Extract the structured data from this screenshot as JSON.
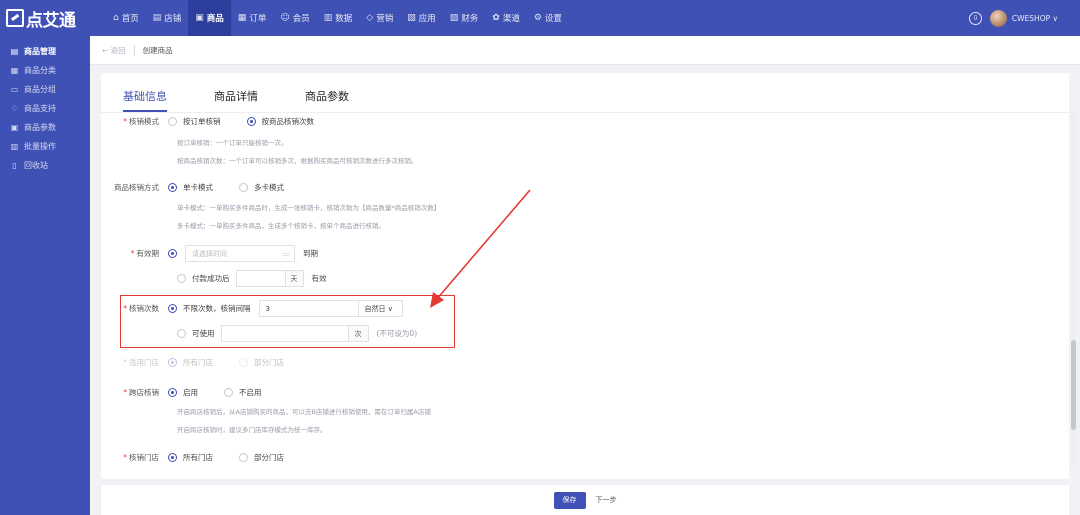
{
  "brand": {
    "logo_text": "点艾通"
  },
  "nav": [
    {
      "label": "首页",
      "icon": "home-icon",
      "glyph": "⌂"
    },
    {
      "label": "店铺",
      "icon": "store-icon",
      "glyph": "▤"
    },
    {
      "label": "商品",
      "icon": "goods-icon",
      "glyph": "▣",
      "active": true
    },
    {
      "label": "订单",
      "icon": "order-icon",
      "glyph": "▦"
    },
    {
      "label": "会员",
      "icon": "member-icon",
      "glyph": "☺"
    },
    {
      "label": "数据",
      "icon": "data-icon",
      "glyph": "▥"
    },
    {
      "label": "营销",
      "icon": "marketing-icon",
      "glyph": "◇"
    },
    {
      "label": "应用",
      "icon": "app-icon",
      "glyph": "▧"
    },
    {
      "label": "财务",
      "icon": "finance-icon",
      "glyph": "▨"
    },
    {
      "label": "渠道",
      "icon": "channel-icon",
      "glyph": "✿"
    },
    {
      "label": "设置",
      "icon": "settings-icon",
      "glyph": "⚙"
    }
  ],
  "user": {
    "name": "CWESHOP ∨",
    "badge_glyph": "⇩"
  },
  "sidebar": {
    "items": [
      {
        "label": "商品管理",
        "glyph": "▤",
        "active": true
      },
      {
        "label": "商品分类",
        "glyph": "▦"
      },
      {
        "label": "商品分组",
        "glyph": "▭"
      },
      {
        "label": "商品支持",
        "glyph": "♢"
      },
      {
        "label": "商品参数",
        "glyph": "▣"
      },
      {
        "label": "批量操作",
        "glyph": "▥"
      },
      {
        "label": "回收站",
        "glyph": "▯"
      }
    ]
  },
  "breadcrumb": {
    "back": "← 返回",
    "current": "创建商品"
  },
  "tabs": [
    {
      "label": "基础信息",
      "active": true
    },
    {
      "label": "商品详情"
    },
    {
      "label": "商品参数"
    }
  ],
  "form": {
    "verify_mode": {
      "label": "核销模式",
      "options": [
        "按订单核销",
        "按商品核销次数"
      ],
      "hint1": "按订单核销：一个订单只能核销一次。",
      "hint2": "按商品核销次数：一个订单可以核销多次，根据购买商品可核销次数进行多次核销。"
    },
    "verify_method": {
      "label": "商品核销方式",
      "options": [
        "单卡模式",
        "多卡模式"
      ],
      "hint1": "单卡模式：一单购买多件商品时，生成一张核销卡，核销次数为【商品数量*商品核销次数】",
      "hint2": "多卡模式：一单购买多件商品，生成多个核销卡，按单个商品进行核销。"
    },
    "validity": {
      "label": "有效期",
      "date_placeholder": "请选择时间",
      "date_suffix": "到期",
      "after_payment": "付款成功后",
      "day_unit": "天",
      "valid": "有效"
    },
    "verify_count": {
      "label": "核销次数",
      "option1": "不限次数，核销间隔",
      "interval_value": "3",
      "interval_unit": "自然日 ∨",
      "option2": "可使用",
      "count_unit": "次",
      "count_hint": "(不可设为0)"
    },
    "applicable_store": {
      "label": "适用门店",
      "options": [
        "所有门店",
        "部分门店"
      ]
    },
    "cross_store": {
      "label": "跨店核销",
      "options": [
        "启用",
        "不启用"
      ],
      "hint1": "开启跨店核销后，从A店铺购买的商品，可以去B店铺进行核销使用，需在订单归属A店铺",
      "hint2": "开启跨店核销时，建议多门店库存模式为统一库存。"
    },
    "verify_store": {
      "label": "核销门店",
      "options": [
        "所有门店",
        "部分门店"
      ]
    }
  },
  "footer": {
    "save": "保存",
    "next": "下一步"
  },
  "colors": {
    "primary": "#3f51b5",
    "annotation": "#e53935"
  }
}
